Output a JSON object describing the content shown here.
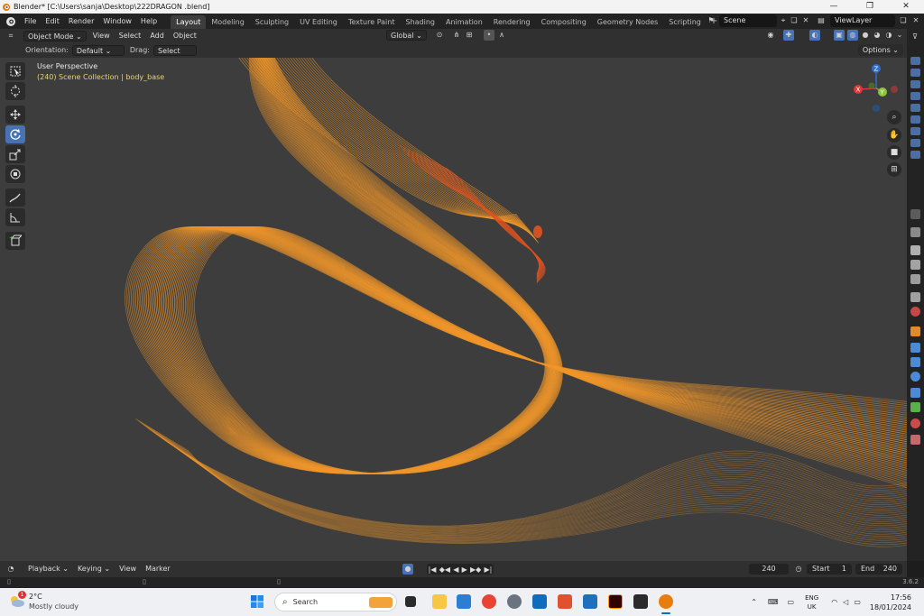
{
  "window": {
    "title": "Blender* [C:\\Users\\sanja\\Desktop\\222DRAGON .blend]",
    "controls": [
      "—",
      "❐",
      "✕"
    ]
  },
  "topbar": {
    "menus": [
      "File",
      "Edit",
      "Render",
      "Window",
      "Help"
    ],
    "workspaces": [
      "Layout",
      "Modeling",
      "Sculpting",
      "UV Editing",
      "Texture Paint",
      "Shading",
      "Animation",
      "Rendering",
      "Compositing",
      "Geometry Nodes",
      "Scripting"
    ],
    "active_workspace": "Layout",
    "add_workspace": "+",
    "scene": "Scene",
    "view_layer": "ViewLayer"
  },
  "viewport_header": {
    "mode": "Object Mode",
    "menus": [
      "View",
      "Select",
      "Add",
      "Object"
    ],
    "transform_orientation": "Global"
  },
  "tool_settings": {
    "orientation_label": "Orientation:",
    "orientation_value": "Default",
    "drag_label": "Drag:",
    "drag_value": "Select Box",
    "options": "Options"
  },
  "viewport": {
    "view_name": "User Perspective",
    "collection_info": "(240) Scene Collection | body_base",
    "wire_color": "#f0962a",
    "wire_color_selected": "#e0531f",
    "background": "#3d3d3d",
    "gizmo_axes": {
      "x": "X",
      "y": "Y",
      "z": "Z"
    }
  },
  "toolbar": {
    "tools": [
      "select-box",
      "cursor",
      "move",
      "rotate",
      "scale",
      "transform",
      "annotate",
      "measure",
      "add-cube"
    ],
    "active_tool": "rotate"
  },
  "timeline": {
    "menus": [
      "Playback",
      "Keying",
      "View",
      "Marker"
    ],
    "current_frame": "240",
    "start_label": "Start",
    "start_value": "1",
    "end_label": "End",
    "end_value": "240"
  },
  "status_bar": {
    "version": "3.6.2"
  },
  "taskbar": {
    "weather_temp": "2°C",
    "weather_desc": "Mostly cloudy",
    "weather_badge": "1",
    "search_placeholder": "Search",
    "language_top": "ENG",
    "language_bottom": "UK",
    "time": "17:56",
    "date": "18/01/2024"
  }
}
